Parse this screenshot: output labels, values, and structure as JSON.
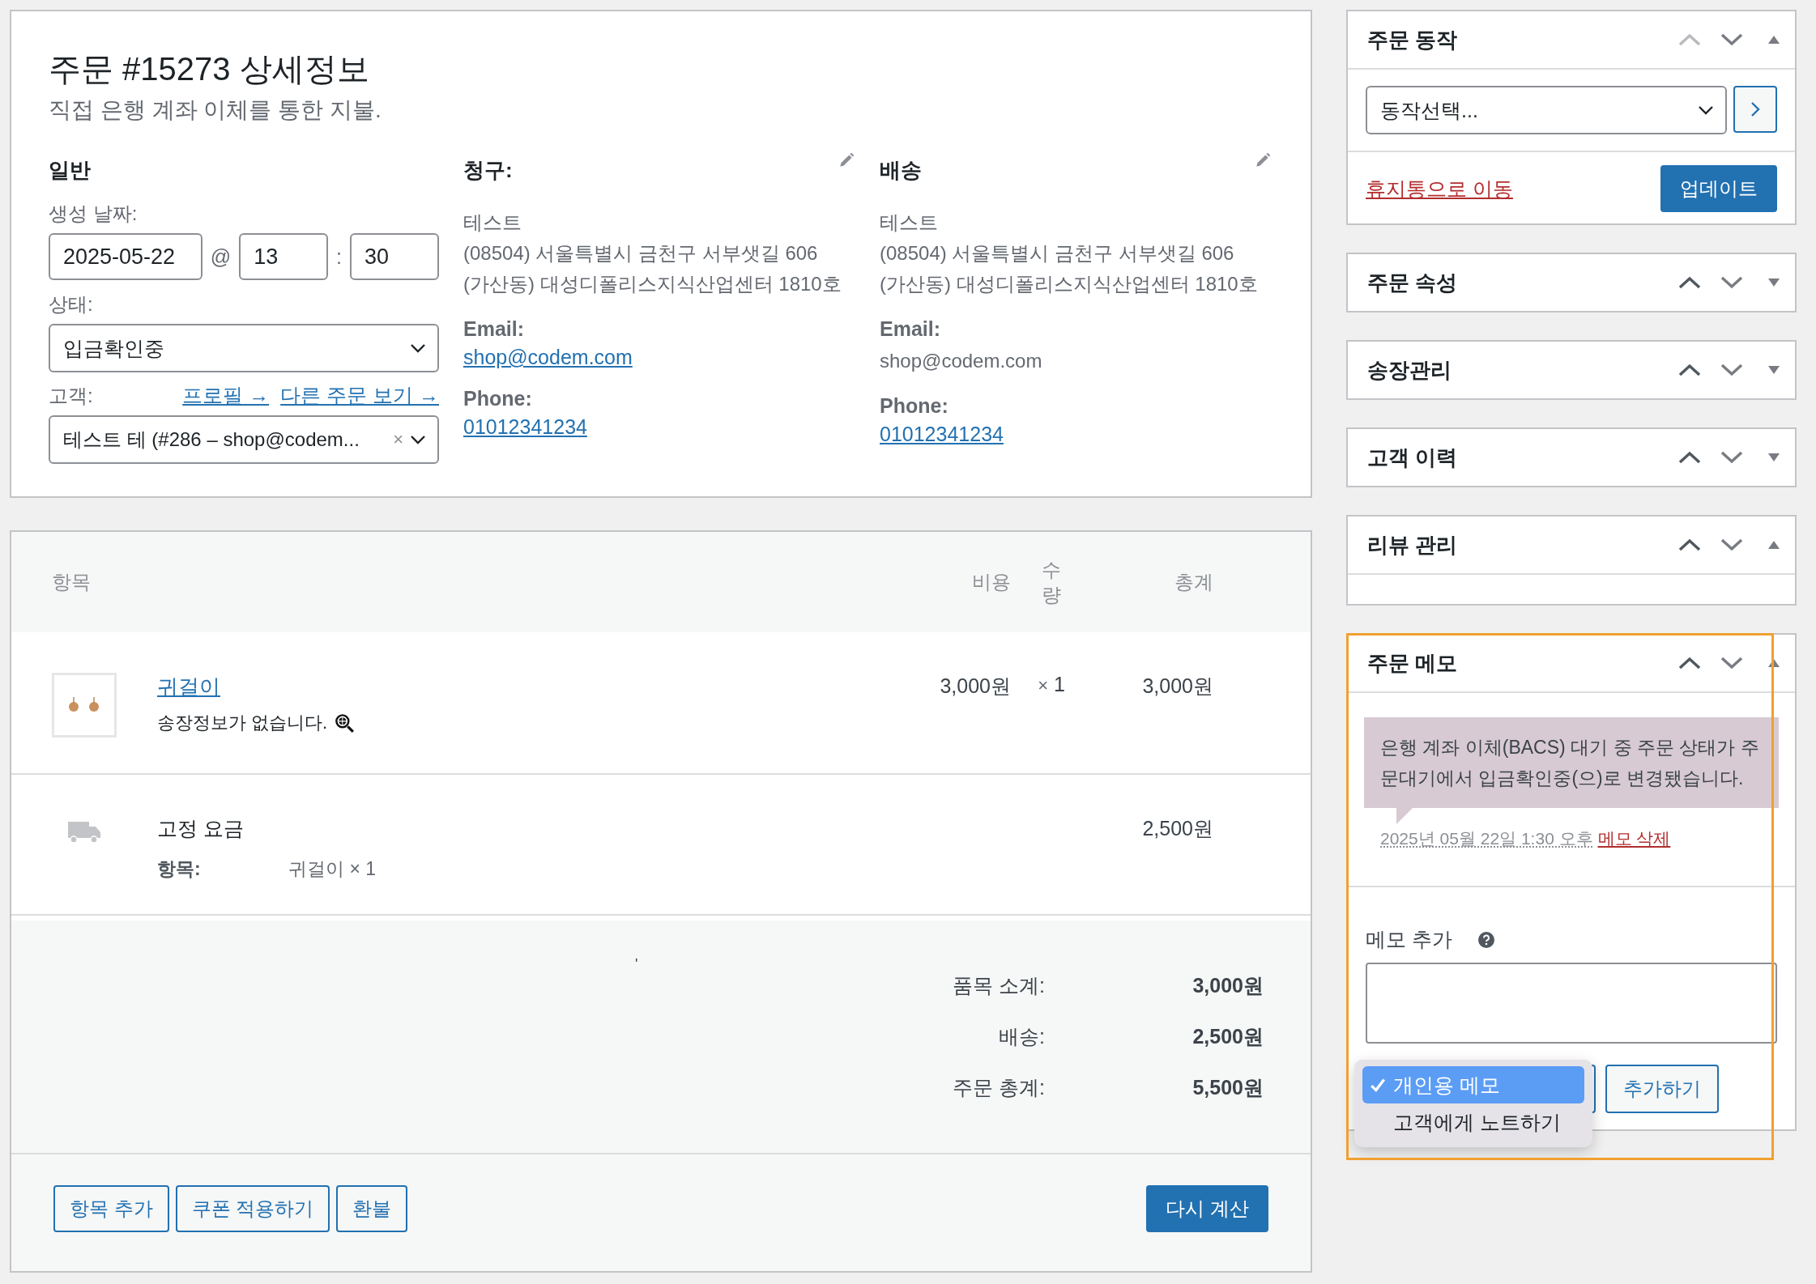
{
  "order": {
    "title": "주문 #15273 상세정보",
    "subtitle": "직접 은행 계좌 이체를 통한 지불.",
    "general": {
      "heading": "일반",
      "date_label": "생성 날짜:",
      "date": "2025-05-22",
      "at": "@",
      "hour": "13",
      "colon": ":",
      "minute": "30",
      "status_label": "상태:",
      "status": "입금확인중",
      "customer_label": "고객:",
      "profile_link": "프로필 →",
      "other_orders_link": "다른 주문 보기 →",
      "customer": "테스트 테 (#286 – shop@codem...",
      "clear": "×"
    },
    "addresses": [
      {
        "heading": "청구:",
        "name": "테스트",
        "address": [
          "(08504) 서울특별시 금천구 서부샛길 606",
          "(가산동) 대성디폴리스지식산업센터 1810호"
        ],
        "email_label": "Email:",
        "email": "shop@codem.com",
        "email_linked": true,
        "phone_label": "Phone:",
        "phone": "01012341234"
      },
      {
        "heading": "배송",
        "name": "테스트",
        "address": [
          "(08504) 서울특별시 금천구 서부샛길 606",
          "(가산동) 대성디폴리스지식산업센터 1810호"
        ],
        "email_label": "Email:",
        "email": "shop@codem.com",
        "email_linked": false,
        "phone_label": "Phone:",
        "phone": "01012341234"
      }
    ]
  },
  "items": {
    "columns": [
      "항목",
      "비용",
      "수량",
      "총계"
    ],
    "rows": [
      {
        "kind": "product",
        "name": "귀걸이",
        "note": "송장정보가 없습니다.",
        "cost": "3,000원",
        "qty_x": "×",
        "qty": "1",
        "total": "3,000원"
      },
      {
        "kind": "shipping",
        "name": "고정 요금",
        "meta_label": "항목:",
        "meta_value": "귀걸이 × 1",
        "total": "2,500원"
      }
    ],
    "stray_mark": "'",
    "totals": [
      {
        "label": "품목 소계:",
        "value": "3,000원"
      },
      {
        "label": "배송:",
        "value": "2,500원"
      },
      {
        "label": "주문 총계:",
        "value": "5,500원"
      }
    ],
    "buttons": [
      {
        "label": "항목 추가",
        "kind": "secondary"
      },
      {
        "label": "쿠폰 적용하기",
        "kind": "secondary"
      },
      {
        "label": "환불",
        "kind": "secondary"
      },
      {
        "label": "다시 계산",
        "kind": "primary"
      }
    ]
  },
  "sidebar": [
    {
      "kind": "actions",
      "title": "주문 동작",
      "expanded": true,
      "can_move_up": false,
      "select": "동작선택...",
      "trash_link": "휴지통으로 이동",
      "update_button": "업데이트"
    },
    {
      "kind": "collapsed",
      "title": "주문 속성",
      "expanded": false,
      "can_move_up": true
    },
    {
      "kind": "collapsed",
      "title": "송장관리",
      "expanded": false,
      "can_move_up": true
    },
    {
      "kind": "collapsed",
      "title": "고객 이력",
      "expanded": false,
      "can_move_up": true
    },
    {
      "kind": "empty",
      "title": "리뷰 관리",
      "expanded": true,
      "can_move_up": true
    },
    {
      "kind": "notes",
      "title": "주문 메모",
      "expanded": true,
      "can_move_up": true,
      "highlighted": true,
      "note": "은행 계좌 이체(BACS) 대기 중 주문 상태가 주문대기에서 입금확인중(으)로 변경됐습니다.",
      "date": "2025년 05월 22일 1:30 오후",
      "delete_link": "메모 삭제",
      "add_label": "메모 추가",
      "note_types": [
        {
          "label": "개인용 메모",
          "selected": true
        },
        {
          "label": "고객에게 노트하기",
          "selected": false
        }
      ],
      "add_button": "추가하기"
    }
  ]
}
